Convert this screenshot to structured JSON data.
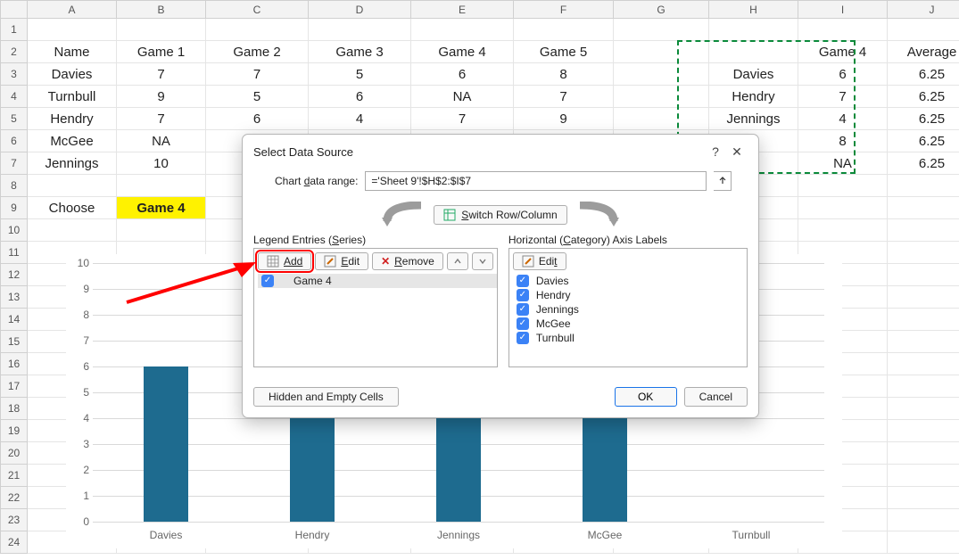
{
  "columns": [
    "A",
    "B",
    "C",
    "D",
    "E",
    "F",
    "G",
    "H",
    "I",
    "J"
  ],
  "rows_count": 24,
  "grid": {
    "A2": "Name",
    "B2": "Game 1",
    "C2": "Game 2",
    "D2": "Game 3",
    "E2": "Game 4",
    "F2": "Game 5",
    "H2": "",
    "I2": "Game 4",
    "J2": "Average",
    "A3": "Davies",
    "B3": "7",
    "C3": "7",
    "D3": "5",
    "E3": "6",
    "F3": "8",
    "H3": "Davies",
    "I3": "6",
    "J3": "6.25",
    "A4": "Turnbull",
    "B4": "9",
    "C4": "5",
    "D4": "6",
    "E4": "NA",
    "F4": "7",
    "H4": "Hendry",
    "I4": "7",
    "J4": "6.25",
    "A5": "Hendry",
    "B5": "7",
    "C5": "6",
    "D5": "4",
    "E5": "7",
    "F5": "9",
    "H5": "Jennings",
    "I5": "4",
    "J5": "6.25",
    "A6": "McGee",
    "B6": "NA",
    "I6": "8",
    "J6": "6.25",
    "A7": "Jennings",
    "B7": "10",
    "I7": "NA",
    "J7": "6.25",
    "A9": "Choose",
    "B9": "Game 4"
  },
  "marquee_label": "H2:I7",
  "dialog": {
    "title": "Select Data Source",
    "range_label": "Chart data range:",
    "range_value": "='Sheet 9'!$H$2:$I$7",
    "switch_label": "Switch Row/Column",
    "legend_title": "Legend Entries (Series)",
    "axis_title": "Horizontal (Category) Axis Labels",
    "btn_add": "Add",
    "btn_edit": "Edit",
    "btn_remove": "Remove",
    "btn_edit2": "Edit",
    "series": [
      "Game 4"
    ],
    "categories": [
      "Davies",
      "Hendry",
      "Jennings",
      "McGee",
      "Turnbull"
    ],
    "btn_hidden": "Hidden and Empty Cells",
    "btn_ok": "OK",
    "btn_cancel": "Cancel"
  },
  "chart_data": {
    "type": "bar",
    "categories": [
      "Davies",
      "Hendry",
      "Jennings",
      "McGee",
      "Turnbull"
    ],
    "series": [
      {
        "name": "Game 4",
        "values": [
          6,
          7,
          4,
          8,
          0
        ]
      }
    ],
    "ylim": [
      0,
      10
    ],
    "yticks": [
      0,
      1,
      2,
      3,
      4,
      5,
      6,
      7,
      8,
      9,
      10
    ],
    "title": "",
    "xlabel": "",
    "ylabel": ""
  }
}
